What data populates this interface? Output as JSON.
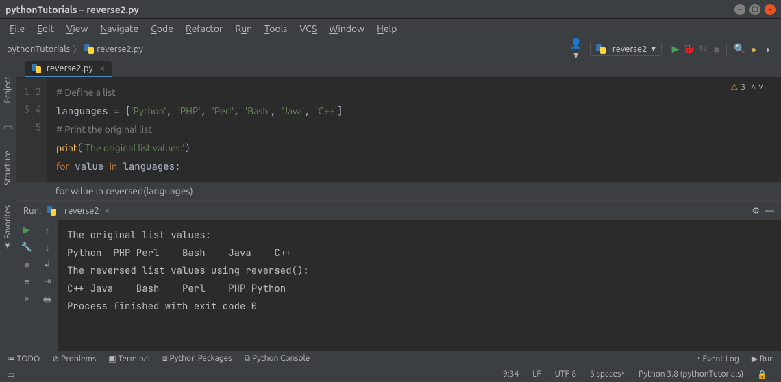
{
  "window": {
    "title": "pythonTutorials – reverse2.py"
  },
  "menu": {
    "file": "File",
    "edit": "Edit",
    "view": "View",
    "navigate": "Navigate",
    "code": "Code",
    "refactor": "Refactor",
    "run": "Run",
    "tools": "Tools",
    "vcs": "VCS",
    "window": "Window",
    "help": "Help"
  },
  "breadcrumb": {
    "project": "pythonTutorials",
    "file": "reverse2.py"
  },
  "run_config": {
    "name": "reverse2"
  },
  "editor": {
    "tab_name": "reverse2.py",
    "warning_count": "3",
    "lines": [
      {
        "n": "1",
        "html": "<span class='cmt'># Define a list</span>"
      },
      {
        "n": "2",
        "html": "languages = [<span class='str'>'Python'</span>, <span class='str'>'PHP'</span>, <span class='str'>'Perl'</span>, <span class='str'>'Bash'</span>, <span class='str'>'Java'</span>, <span class='str'>'C++'</span>]"
      },
      {
        "n": "3",
        "html": "<span class='cmt'># Print the original list</span>"
      },
      {
        "n": "4",
        "html": "<span class='fn'>print</span>(<span class='str'>'The original list values:'</span>)"
      },
      {
        "n": "5",
        "html": "<span class='kw'>for</span> value <span class='kw'>in</span> languages:"
      }
    ],
    "hint": "for value in reversed(languages)"
  },
  "left_tabs": {
    "project": "Project",
    "structure": "Structure",
    "favorites": "Favorites"
  },
  "run_panel": {
    "label": "Run:",
    "config": "reverse2",
    "output": "The original list values:\nPython  PHP Perl    Bash    Java    C++\nThe reversed list values using reversed():\nC++ Java    Bash    Perl    PHP Python\nProcess finished with exit code 0"
  },
  "bottom_tools": {
    "todo": "TODO",
    "problems": "Problems",
    "terminal": "Terminal",
    "python_packages": "Python Packages",
    "python_console": "Python Console",
    "event_log": "Event Log",
    "run": "Run"
  },
  "status": {
    "pos": "9:34",
    "line_sep": "LF",
    "encoding": "UTF-8",
    "indent": "3 spaces*",
    "interpreter": "Python 3.8 (pythonTutorials)"
  }
}
